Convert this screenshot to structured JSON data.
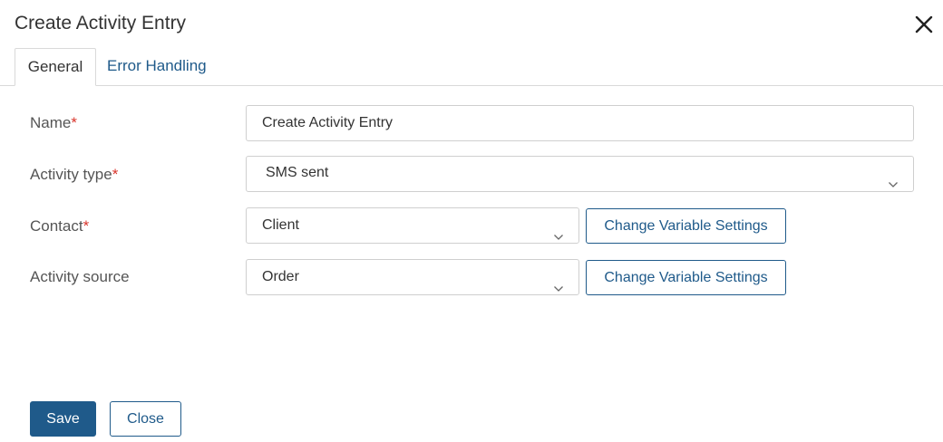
{
  "dialog": {
    "title": "Create Activity Entry"
  },
  "tabs": [
    {
      "label": "General",
      "active": true
    },
    {
      "label": "Error Handling",
      "active": false
    }
  ],
  "form": {
    "required_marker": "*",
    "name": {
      "label": "Name",
      "value": "Create Activity Entry"
    },
    "activity_type": {
      "label": "Activity type",
      "value": "SMS sent"
    },
    "contact": {
      "label": "Contact",
      "value": "Client",
      "button": "Change Variable Settings"
    },
    "activity_source": {
      "label": "Activity source",
      "value": "Order",
      "button": "Change Variable Settings"
    }
  },
  "footer": {
    "save": "Save",
    "close": "Close"
  },
  "colors": {
    "accent": "#1f5a8a",
    "required": "#d9342b",
    "border": "#cfcfcf"
  },
  "icons": {
    "close": "close-icon",
    "dropdown": "chevron-down-icon"
  }
}
